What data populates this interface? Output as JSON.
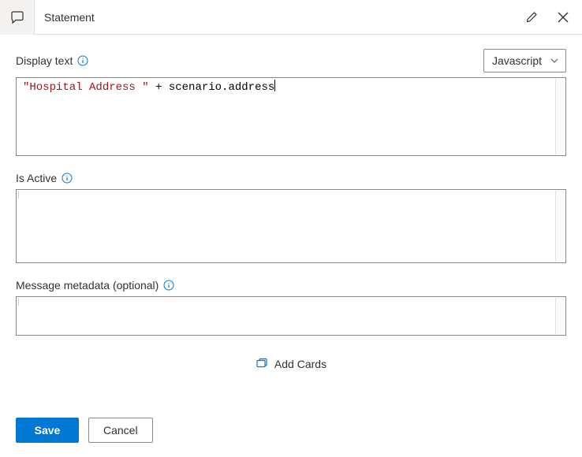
{
  "header": {
    "title": "Statement"
  },
  "fields": {
    "displayText": {
      "label": "Display text",
      "dropdown": "Javascript",
      "code_str": "\"Hospital Address \"",
      "code_rest": " + scenario.address"
    },
    "isActive": {
      "label": "Is Active"
    },
    "metadata": {
      "label": "Message metadata (optional)"
    }
  },
  "addCards": {
    "label": "Add Cards"
  },
  "buttons": {
    "save": "Save",
    "cancel": "Cancel"
  }
}
